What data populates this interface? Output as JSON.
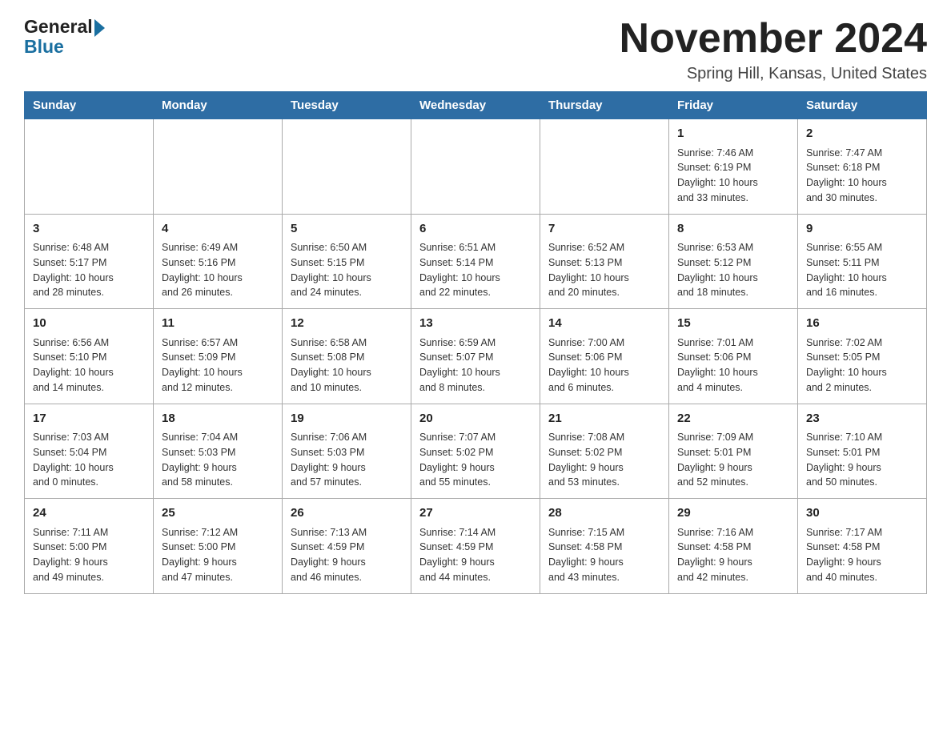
{
  "header": {
    "logo_general": "General",
    "logo_blue": "Blue",
    "title": "November 2024",
    "subtitle": "Spring Hill, Kansas, United States"
  },
  "days_of_week": [
    "Sunday",
    "Monday",
    "Tuesday",
    "Wednesday",
    "Thursday",
    "Friday",
    "Saturday"
  ],
  "weeks": [
    [
      {
        "day": "",
        "info": ""
      },
      {
        "day": "",
        "info": ""
      },
      {
        "day": "",
        "info": ""
      },
      {
        "day": "",
        "info": ""
      },
      {
        "day": "",
        "info": ""
      },
      {
        "day": "1",
        "info": "Sunrise: 7:46 AM\nSunset: 6:19 PM\nDaylight: 10 hours\nand 33 minutes."
      },
      {
        "day": "2",
        "info": "Sunrise: 7:47 AM\nSunset: 6:18 PM\nDaylight: 10 hours\nand 30 minutes."
      }
    ],
    [
      {
        "day": "3",
        "info": "Sunrise: 6:48 AM\nSunset: 5:17 PM\nDaylight: 10 hours\nand 28 minutes."
      },
      {
        "day": "4",
        "info": "Sunrise: 6:49 AM\nSunset: 5:16 PM\nDaylight: 10 hours\nand 26 minutes."
      },
      {
        "day": "5",
        "info": "Sunrise: 6:50 AM\nSunset: 5:15 PM\nDaylight: 10 hours\nand 24 minutes."
      },
      {
        "day": "6",
        "info": "Sunrise: 6:51 AM\nSunset: 5:14 PM\nDaylight: 10 hours\nand 22 minutes."
      },
      {
        "day": "7",
        "info": "Sunrise: 6:52 AM\nSunset: 5:13 PM\nDaylight: 10 hours\nand 20 minutes."
      },
      {
        "day": "8",
        "info": "Sunrise: 6:53 AM\nSunset: 5:12 PM\nDaylight: 10 hours\nand 18 minutes."
      },
      {
        "day": "9",
        "info": "Sunrise: 6:55 AM\nSunset: 5:11 PM\nDaylight: 10 hours\nand 16 minutes."
      }
    ],
    [
      {
        "day": "10",
        "info": "Sunrise: 6:56 AM\nSunset: 5:10 PM\nDaylight: 10 hours\nand 14 minutes."
      },
      {
        "day": "11",
        "info": "Sunrise: 6:57 AM\nSunset: 5:09 PM\nDaylight: 10 hours\nand 12 minutes."
      },
      {
        "day": "12",
        "info": "Sunrise: 6:58 AM\nSunset: 5:08 PM\nDaylight: 10 hours\nand 10 minutes."
      },
      {
        "day": "13",
        "info": "Sunrise: 6:59 AM\nSunset: 5:07 PM\nDaylight: 10 hours\nand 8 minutes."
      },
      {
        "day": "14",
        "info": "Sunrise: 7:00 AM\nSunset: 5:06 PM\nDaylight: 10 hours\nand 6 minutes."
      },
      {
        "day": "15",
        "info": "Sunrise: 7:01 AM\nSunset: 5:06 PM\nDaylight: 10 hours\nand 4 minutes."
      },
      {
        "day": "16",
        "info": "Sunrise: 7:02 AM\nSunset: 5:05 PM\nDaylight: 10 hours\nand 2 minutes."
      }
    ],
    [
      {
        "day": "17",
        "info": "Sunrise: 7:03 AM\nSunset: 5:04 PM\nDaylight: 10 hours\nand 0 minutes."
      },
      {
        "day": "18",
        "info": "Sunrise: 7:04 AM\nSunset: 5:03 PM\nDaylight: 9 hours\nand 58 minutes."
      },
      {
        "day": "19",
        "info": "Sunrise: 7:06 AM\nSunset: 5:03 PM\nDaylight: 9 hours\nand 57 minutes."
      },
      {
        "day": "20",
        "info": "Sunrise: 7:07 AM\nSunset: 5:02 PM\nDaylight: 9 hours\nand 55 minutes."
      },
      {
        "day": "21",
        "info": "Sunrise: 7:08 AM\nSunset: 5:02 PM\nDaylight: 9 hours\nand 53 minutes."
      },
      {
        "day": "22",
        "info": "Sunrise: 7:09 AM\nSunset: 5:01 PM\nDaylight: 9 hours\nand 52 minutes."
      },
      {
        "day": "23",
        "info": "Sunrise: 7:10 AM\nSunset: 5:01 PM\nDaylight: 9 hours\nand 50 minutes."
      }
    ],
    [
      {
        "day": "24",
        "info": "Sunrise: 7:11 AM\nSunset: 5:00 PM\nDaylight: 9 hours\nand 49 minutes."
      },
      {
        "day": "25",
        "info": "Sunrise: 7:12 AM\nSunset: 5:00 PM\nDaylight: 9 hours\nand 47 minutes."
      },
      {
        "day": "26",
        "info": "Sunrise: 7:13 AM\nSunset: 4:59 PM\nDaylight: 9 hours\nand 46 minutes."
      },
      {
        "day": "27",
        "info": "Sunrise: 7:14 AM\nSunset: 4:59 PM\nDaylight: 9 hours\nand 44 minutes."
      },
      {
        "day": "28",
        "info": "Sunrise: 7:15 AM\nSunset: 4:58 PM\nDaylight: 9 hours\nand 43 minutes."
      },
      {
        "day": "29",
        "info": "Sunrise: 7:16 AM\nSunset: 4:58 PM\nDaylight: 9 hours\nand 42 minutes."
      },
      {
        "day": "30",
        "info": "Sunrise: 7:17 AM\nSunset: 4:58 PM\nDaylight: 9 hours\nand 40 minutes."
      }
    ]
  ]
}
